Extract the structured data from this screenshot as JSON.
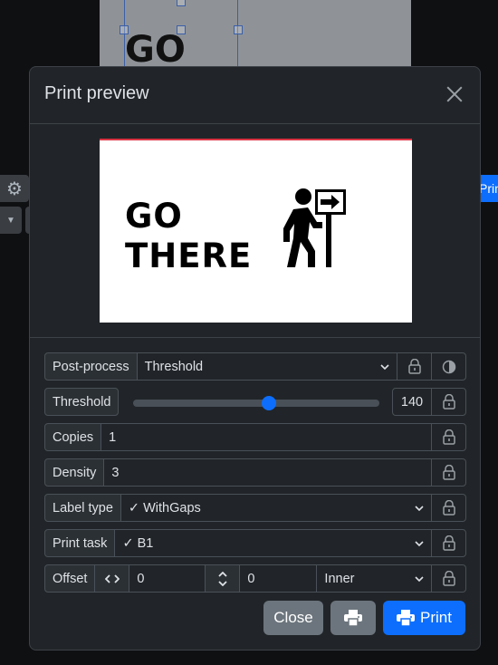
{
  "background": {
    "canvas_text": "GO",
    "print_button_label": "Print"
  },
  "modal": {
    "title": "Print preview",
    "preview": {
      "line1": "GO",
      "line2": "THERE"
    },
    "post_process": {
      "label": "Post-process",
      "value": "Threshold"
    },
    "threshold": {
      "label": "Threshold",
      "value": "140",
      "fraction": 0.55
    },
    "copies": {
      "label": "Copies",
      "value": "1"
    },
    "density": {
      "label": "Density",
      "value": "3"
    },
    "label_type": {
      "label": "Label type",
      "value": "✓ WithGaps"
    },
    "print_task": {
      "label": "Print task",
      "value": "✓ B1"
    },
    "offset": {
      "label": "Offset",
      "x": "0",
      "y": "0",
      "mode": "Inner"
    },
    "buttons": {
      "close": "Close",
      "print": "Print"
    }
  },
  "colors": {
    "primary": "#0d6efd",
    "secondary": "#6c757d",
    "accent_line": "#dc3545"
  },
  "icons": [
    "gear-icon",
    "close-icon",
    "lock-icon",
    "contrast-icon",
    "chevron-down-icon",
    "arrows-horizontal-icon",
    "arrows-vertical-icon",
    "printer-icon",
    "person-sign-icon"
  ]
}
